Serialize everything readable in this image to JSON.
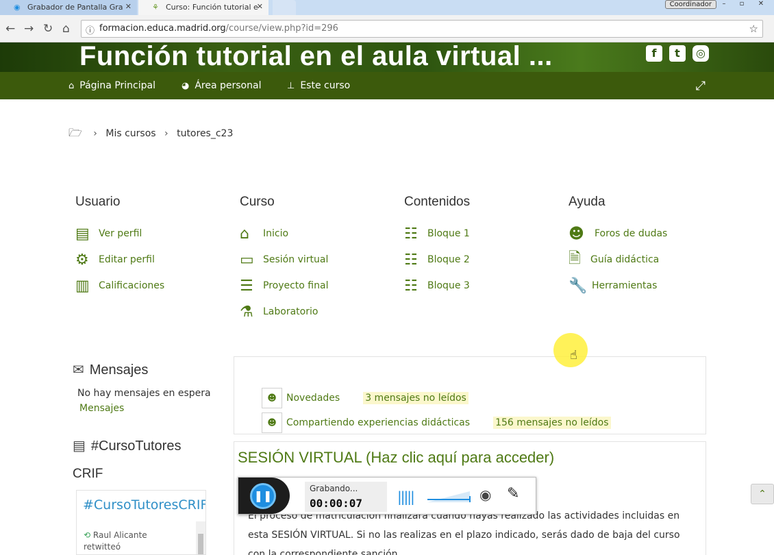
{
  "browser": {
    "tabs": [
      {
        "label": "Grabador de Pantalla Gra",
        "icon": "recorder-icon"
      },
      {
        "label": "Curso: Función tutorial e",
        "icon": "moodle-icon"
      }
    ],
    "user_badge": "Coordinador",
    "url_host": "formacion.educa.madrid.org",
    "url_path": "/course/view.php?id=296"
  },
  "header": {
    "title": "Función tutorial en el aula virtual ...",
    "social": [
      "facebook-icon",
      "twitter-icon",
      "instagram-icon"
    ]
  },
  "nav": {
    "items": [
      {
        "label": "Página Principal",
        "icon": "home-icon"
      },
      {
        "label": "Área personal",
        "icon": "dashboard-icon"
      },
      {
        "label": "Este curso",
        "icon": "sitemap-icon"
      }
    ]
  },
  "breadcrumb": {
    "items": [
      "Mis cursos",
      "tutores_c23"
    ]
  },
  "menu": {
    "columns": [
      {
        "title": "Usuario",
        "items": [
          {
            "label": "Ver perfil",
            "icon": "id-card-icon"
          },
          {
            "label": "Editar perfil",
            "icon": "gear-icon"
          },
          {
            "label": "Calificaciones",
            "icon": "bar-chart-icon"
          }
        ]
      },
      {
        "title": "Curso",
        "items": [
          {
            "label": "Inicio",
            "icon": "home-icon"
          },
          {
            "label": "Sesión virtual",
            "icon": "laptop-icon"
          },
          {
            "label": "Proyecto final",
            "icon": "server-icon"
          },
          {
            "label": "Laboratorio",
            "icon": "flask-icon"
          }
        ]
      },
      {
        "title": "Contenidos",
        "items": [
          {
            "label": "Bloque 1",
            "icon": "ordered-list-icon"
          },
          {
            "label": "Bloque 2",
            "icon": "ordered-list-icon"
          },
          {
            "label": "Bloque 3",
            "icon": "ordered-list-icon"
          }
        ]
      },
      {
        "title": "Ayuda",
        "items": [
          {
            "label": "Foros de dudas",
            "icon": "users-icon"
          },
          {
            "label": "Guía didáctica",
            "icon": "document-icon"
          },
          {
            "label": "Herramientas",
            "icon": "wrench-icon"
          }
        ]
      }
    ]
  },
  "messages": {
    "title": "Mensajes",
    "empty_text": "No hay mensajes en espera",
    "link": "Mensajes"
  },
  "twitter_block": {
    "title": "#CursoTutores",
    "title_line2": "CRIF",
    "hashtag": "#CursoTutoresCRIF",
    "user": "Raul Alicante",
    "action": "retwitteó"
  },
  "forums": [
    {
      "name": "Novedades",
      "unread": "3 mensajes no leídos"
    },
    {
      "name": "Compartiendo experiencias didácticas",
      "unread": "156 mensajes no leídos"
    }
  ],
  "session": {
    "title": "SESIÓN VIRTUAL (Haz clic aquí para acceder)",
    "text": "El proceso de matriculación finalizará cuando hayas realizado las actividades incluidas en esta SESIÓN VIRTUAL. Si no las realizas en el plazo indicado, serás dado de baja del curso con la correspondiente sanción."
  },
  "recorder": {
    "status": "Grabando...",
    "time": "00:00:07"
  },
  "colors": {
    "accent": "#4f7a15",
    "navbar": "#3c5a0c",
    "recorder_blue": "#1f8ee0"
  }
}
